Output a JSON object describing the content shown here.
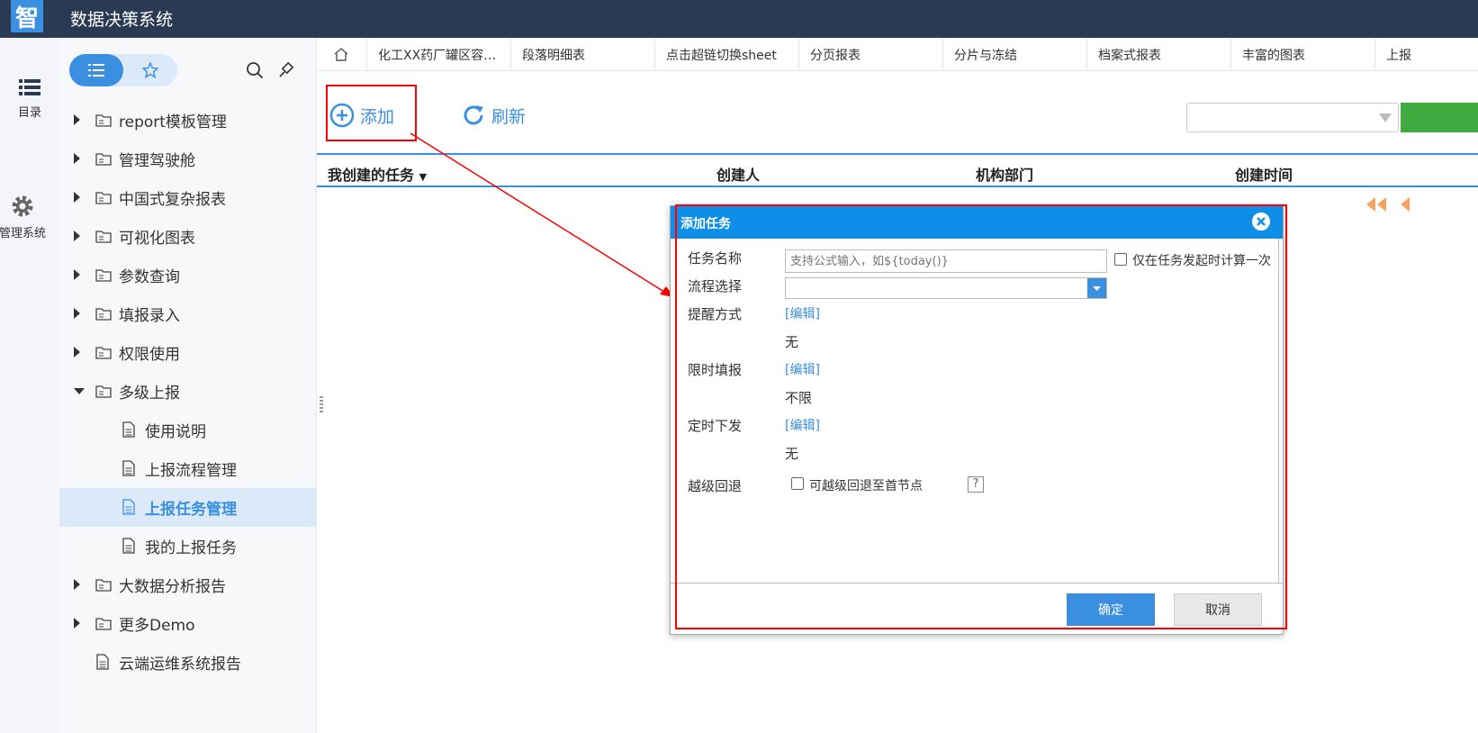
{
  "app": {
    "logo_char": "智",
    "title": "数据决策系统"
  },
  "rail": {
    "catalog_label": "目录",
    "admin_label": "管理系统"
  },
  "sidebar": {
    "tree": [
      {
        "label": "report模板管理"
      },
      {
        "label": "管理驾驶舱"
      },
      {
        "label": "中国式复杂报表"
      },
      {
        "label": "可视化图表"
      },
      {
        "label": "参数查询"
      },
      {
        "label": "填报录入"
      },
      {
        "label": "权限使用"
      },
      {
        "label": "多级上报"
      },
      {
        "label": "使用说明"
      },
      {
        "label": "上报流程管理"
      },
      {
        "label": "上报任务管理"
      },
      {
        "label": "我的上报任务"
      },
      {
        "label": "大数据分析报告"
      },
      {
        "label": "更多Demo"
      },
      {
        "label": "云端运维系统报告"
      }
    ]
  },
  "tabs": [
    "化工XX药厂罐区容…",
    "段落明细表",
    "点击超链切换sheet",
    "分页报表",
    "分片与冻结",
    "档案式报表",
    "丰富的图表",
    "上报"
  ],
  "toolbar": {
    "add_label": "添加",
    "refresh_label": "刷新"
  },
  "grid": {
    "columns": [
      "我创建的任务",
      "创建人",
      "机构部门",
      "创建时间"
    ]
  },
  "dialog": {
    "title": "添加任务",
    "task_name_label": "任务名称",
    "task_name_placeholder": "支持公式输入，如${today()}",
    "compute_once_label": "仅在任务发起时计算一次",
    "flow_label": "流程选择",
    "remind_label": "提醒方式",
    "remind_edit": "[编辑]",
    "remind_value": "无",
    "deadline_label": "限时填报",
    "deadline_edit": "[编辑]",
    "deadline_value": "不限",
    "schedule_label": "定时下发",
    "schedule_edit": "[编辑]",
    "schedule_value": "无",
    "skip_label": "越级回退",
    "skip_checkbox_label": "可越级回退至首节点",
    "help_char": "?",
    "ok_label": "确定",
    "cancel_label": "取消"
  },
  "colors": {
    "topbar": "#2a3a52",
    "accent": "#3a8fe0",
    "dialog_header": "#0e8ee9",
    "annotation": "#ff0000"
  }
}
